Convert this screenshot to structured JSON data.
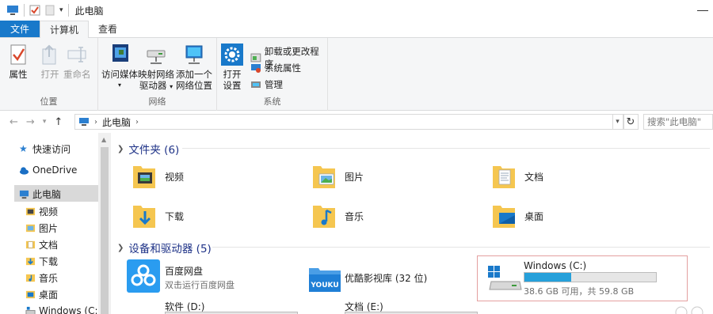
{
  "window": {
    "title": "此电脑"
  },
  "tabs": {
    "file": "文件",
    "computer": "计算机",
    "view": "查看"
  },
  "ribbon": {
    "location": {
      "label": "位置",
      "properties": "属性",
      "open": "打开",
      "rename": "重命名"
    },
    "network": {
      "label": "网络",
      "access_media_1": "访问媒体",
      "map_drive_1": "映射网络",
      "map_drive_2": "驱动器",
      "add_location_1": "添加一个",
      "add_location_2": "网络位置"
    },
    "system": {
      "label": "系统",
      "open_settings_1": "打开",
      "open_settings_2": "设置",
      "uninstall": "卸载或更改程序",
      "system_properties": "系统属性",
      "manage": "管理"
    }
  },
  "address": {
    "path": "此电脑",
    "search_placeholder": "搜索\"此电脑\""
  },
  "navpane": {
    "quick_access": "快速访问",
    "onedrive": "OneDrive",
    "this_pc": "此电脑",
    "items": [
      "视频",
      "图片",
      "文档",
      "下载",
      "音乐",
      "桌面",
      "Windows (C:)"
    ]
  },
  "content": {
    "folders_header": "文件夹 (6)",
    "folders": [
      "视频",
      "图片",
      "文档",
      "下载",
      "音乐",
      "桌面"
    ],
    "devices_header": "设备和驱动器 (5)",
    "baidu": {
      "name": "百度网盘",
      "sub": "双击运行百度网盘"
    },
    "youku": {
      "name": "优酷影视库 (32 位)",
      "logo": "YOUKU"
    },
    "drive_c": {
      "name": "Windows (C:)",
      "sub": "38.6 GB 可用，共 59.8 GB",
      "used_fraction": 0.355
    },
    "drive_d": {
      "name": "软件 (D:)"
    },
    "drive_e": {
      "name": "文档 (E:)"
    }
  },
  "colors": {
    "accent": "#1979ca",
    "folder": "#f5c650",
    "drive_bar": "#26a0da",
    "header_text": "#1e3287"
  }
}
